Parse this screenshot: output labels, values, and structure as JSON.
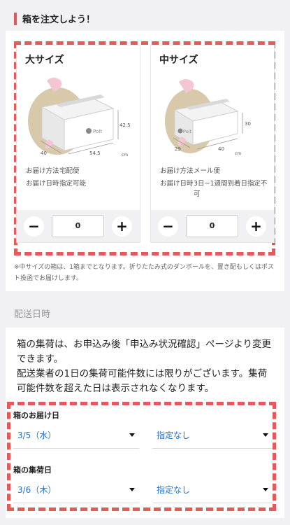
{
  "order": {
    "heading": "箱を注文しよう！",
    "large": {
      "name": "大サイズ",
      "dims": {
        "h": "42.5",
        "w": "54.5",
        "d": "40",
        "unit": "cm"
      },
      "brand": "Polt",
      "method_label": "お届け方法",
      "method_value": "宅配便",
      "date_label": "お届け日時",
      "date_value": "指定可能",
      "quantity": "0"
    },
    "medium": {
      "name": "中サイズ",
      "dims": {
        "h": "30",
        "w": "40",
        "d": "29",
        "unit": "cm"
      },
      "brand": "Polt",
      "method_label": "お届け方法",
      "method_value": "メール便",
      "date_label": "お届け日時",
      "date_value": "3日~1週間到着日指定不可",
      "quantity": "0"
    },
    "minus": "−",
    "plus": "+",
    "note": "※中サイズの箱は、1箱までとなります。折りたたみ式のダンボールを、置き配もしくはポスト投函でお届けします。"
  },
  "delivery": {
    "heading": "配送日時",
    "description_1": "箱の集荷は、お申込み後「申込み状況確認」ページより変更できます。",
    "description_2": "配送業者の1日の集荷可能件数には限りがございます。集荷可能件数を超えた日は表示されなくなります。",
    "delivery_date_label": "箱のお届け日",
    "delivery_date_value": "3/5（水）",
    "delivery_time_value": "指定なし",
    "pickup_date_label": "箱の集荷日",
    "pickup_date_value": "3/6（木）",
    "pickup_time_value": "指定なし"
  },
  "colors": {
    "accent": "#e2575a",
    "link": "#2673c9",
    "page_bg": "#f1f1f3"
  }
}
